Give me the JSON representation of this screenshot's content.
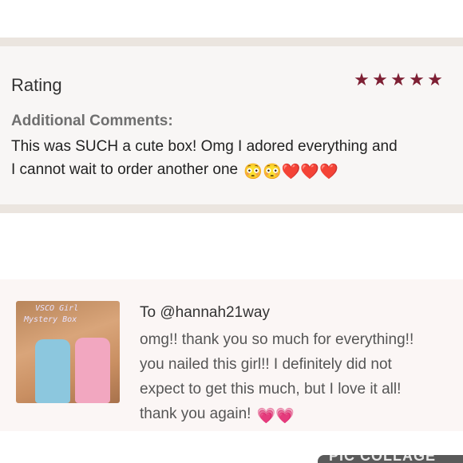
{
  "review": {
    "rating_label": "Rating",
    "stars": 5,
    "star_color": "#7d1f33",
    "additional_label": "Additional Comments:",
    "comment_line1": "This was SUCH a cute box! Omg I adored everything and",
    "comment_line2": "I cannot wait to order another one",
    "comment_emojis": "😳😳❤️❤️❤️"
  },
  "message": {
    "thumb_text_line1": "VSCO Girl",
    "thumb_text_line2": "Mystery Box",
    "to": "To @hannah21way",
    "lines": [
      "omg!! thank you so much for everything!!",
      "you nailed this girl!! I definitely did not",
      "expect to get this much, but I love it all!",
      "thank you again!"
    ],
    "emojis": "💗💗"
  },
  "watermark": "PIC COLLAGE"
}
